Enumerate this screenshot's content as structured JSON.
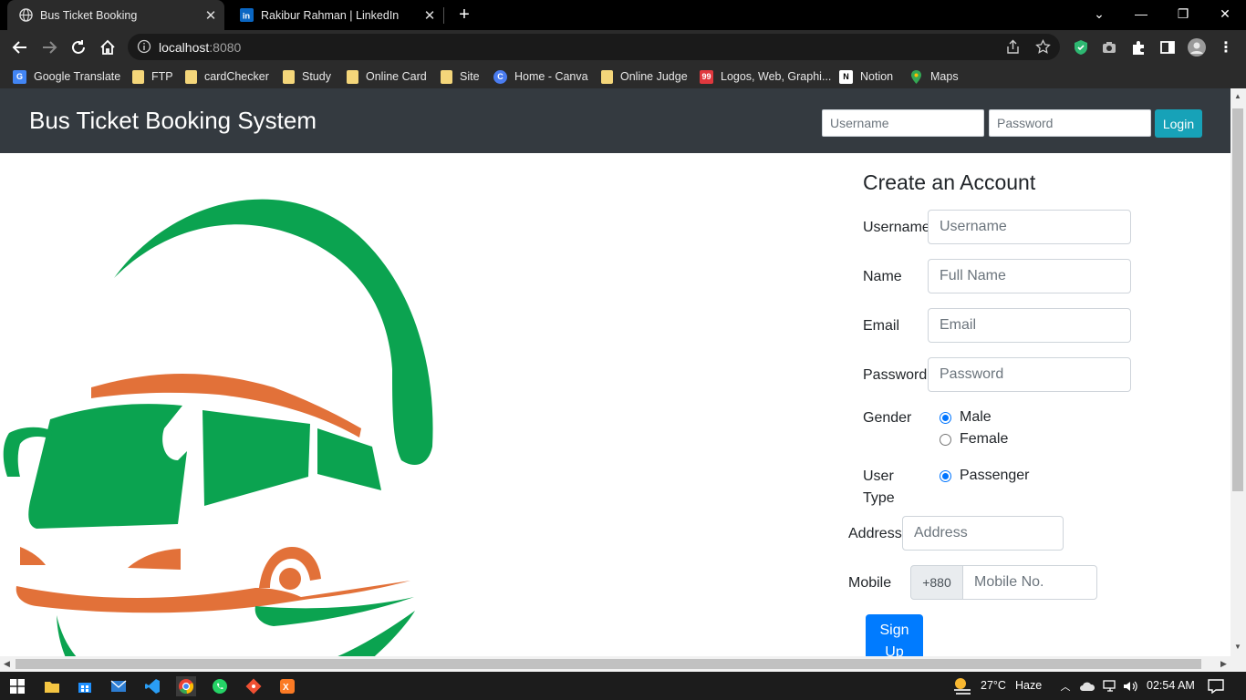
{
  "browser": {
    "tabs": [
      {
        "title": "Bus Ticket Booking",
        "active": true,
        "icon": "globe-icon"
      },
      {
        "title": "Rakibur Rahman | LinkedIn",
        "active": false,
        "icon": "linkedin-icon"
      }
    ],
    "address": {
      "host": "localhost",
      "port": ":8080"
    },
    "bookmarks": [
      {
        "label": "Google Translate",
        "icon": "google-translate-icon"
      },
      {
        "label": "FTP",
        "icon": "folder-icon"
      },
      {
        "label": "cardChecker",
        "icon": "folder-icon"
      },
      {
        "label": "Study",
        "icon": "folder-icon"
      },
      {
        "label": "Online Card",
        "icon": "folder-icon"
      },
      {
        "label": "Site",
        "icon": "folder-icon"
      },
      {
        "label": "Home - Canva",
        "icon": "canva-icon"
      },
      {
        "label": "Online Judge",
        "icon": "folder-icon"
      },
      {
        "label": "Logos, Web, Graphi...",
        "icon": "99designs-icon"
      },
      {
        "label": "Notion",
        "icon": "notion-icon"
      },
      {
        "label": "Maps",
        "icon": "maps-icon"
      }
    ]
  },
  "header": {
    "brand": "Bus Ticket Booking System",
    "username_placeholder": "Username",
    "password_placeholder": "Password",
    "login_label": "Login"
  },
  "form": {
    "title": "Create an Account",
    "username": {
      "label": "Username",
      "placeholder": "Username"
    },
    "name": {
      "label": "Name",
      "placeholder": "Full Name"
    },
    "email": {
      "label": "Email",
      "placeholder": "Email"
    },
    "password": {
      "label": "Password",
      "placeholder": "Password"
    },
    "gender": {
      "label": "Gender",
      "options": [
        "Male",
        "Female"
      ],
      "selected": "Male"
    },
    "user_type": {
      "label_line1": "User",
      "label_line2": "Type",
      "options": [
        "Passenger"
      ],
      "selected": "Passenger"
    },
    "address": {
      "label": "Address",
      "placeholder": "Address"
    },
    "mobile": {
      "label": "Mobile",
      "prefix": "+880",
      "placeholder": "Mobile No."
    },
    "signup_line1": "Sign",
    "signup_line2": "Up"
  },
  "taskbar": {
    "weather": {
      "temp": "27°C",
      "condition": "Haze"
    },
    "time": "02:54 AM"
  },
  "colors": {
    "header_bg": "#343a40",
    "login_btn": "#17a2b8",
    "signup_btn": "#007bff",
    "logo_green": "#0ba350",
    "logo_orange": "#e27139"
  }
}
